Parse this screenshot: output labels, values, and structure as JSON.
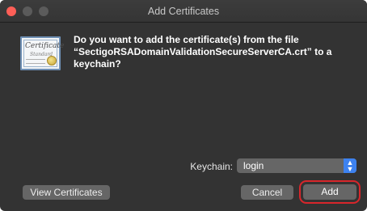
{
  "window": {
    "title": "Add Certificates"
  },
  "certificate_icon": {
    "name": "certificate-icon",
    "script_title": "Certificate",
    "script_subtitle": "Standard"
  },
  "message": "Do you want to add the certificate(s) from the file “SectigoRSADomainValidationSecureServerCA.crt” to a keychain?",
  "keychain": {
    "label": "Keychain:",
    "selected": "login"
  },
  "buttons": {
    "view_certificates": "View Certificates",
    "cancel": "Cancel",
    "add": "Add"
  },
  "colors": {
    "window_bg": "#333333",
    "button_bg": "#666666",
    "select_accent": "#3d82f0",
    "highlight_ring": "#d8262b",
    "close_button": "#fe5f57"
  }
}
